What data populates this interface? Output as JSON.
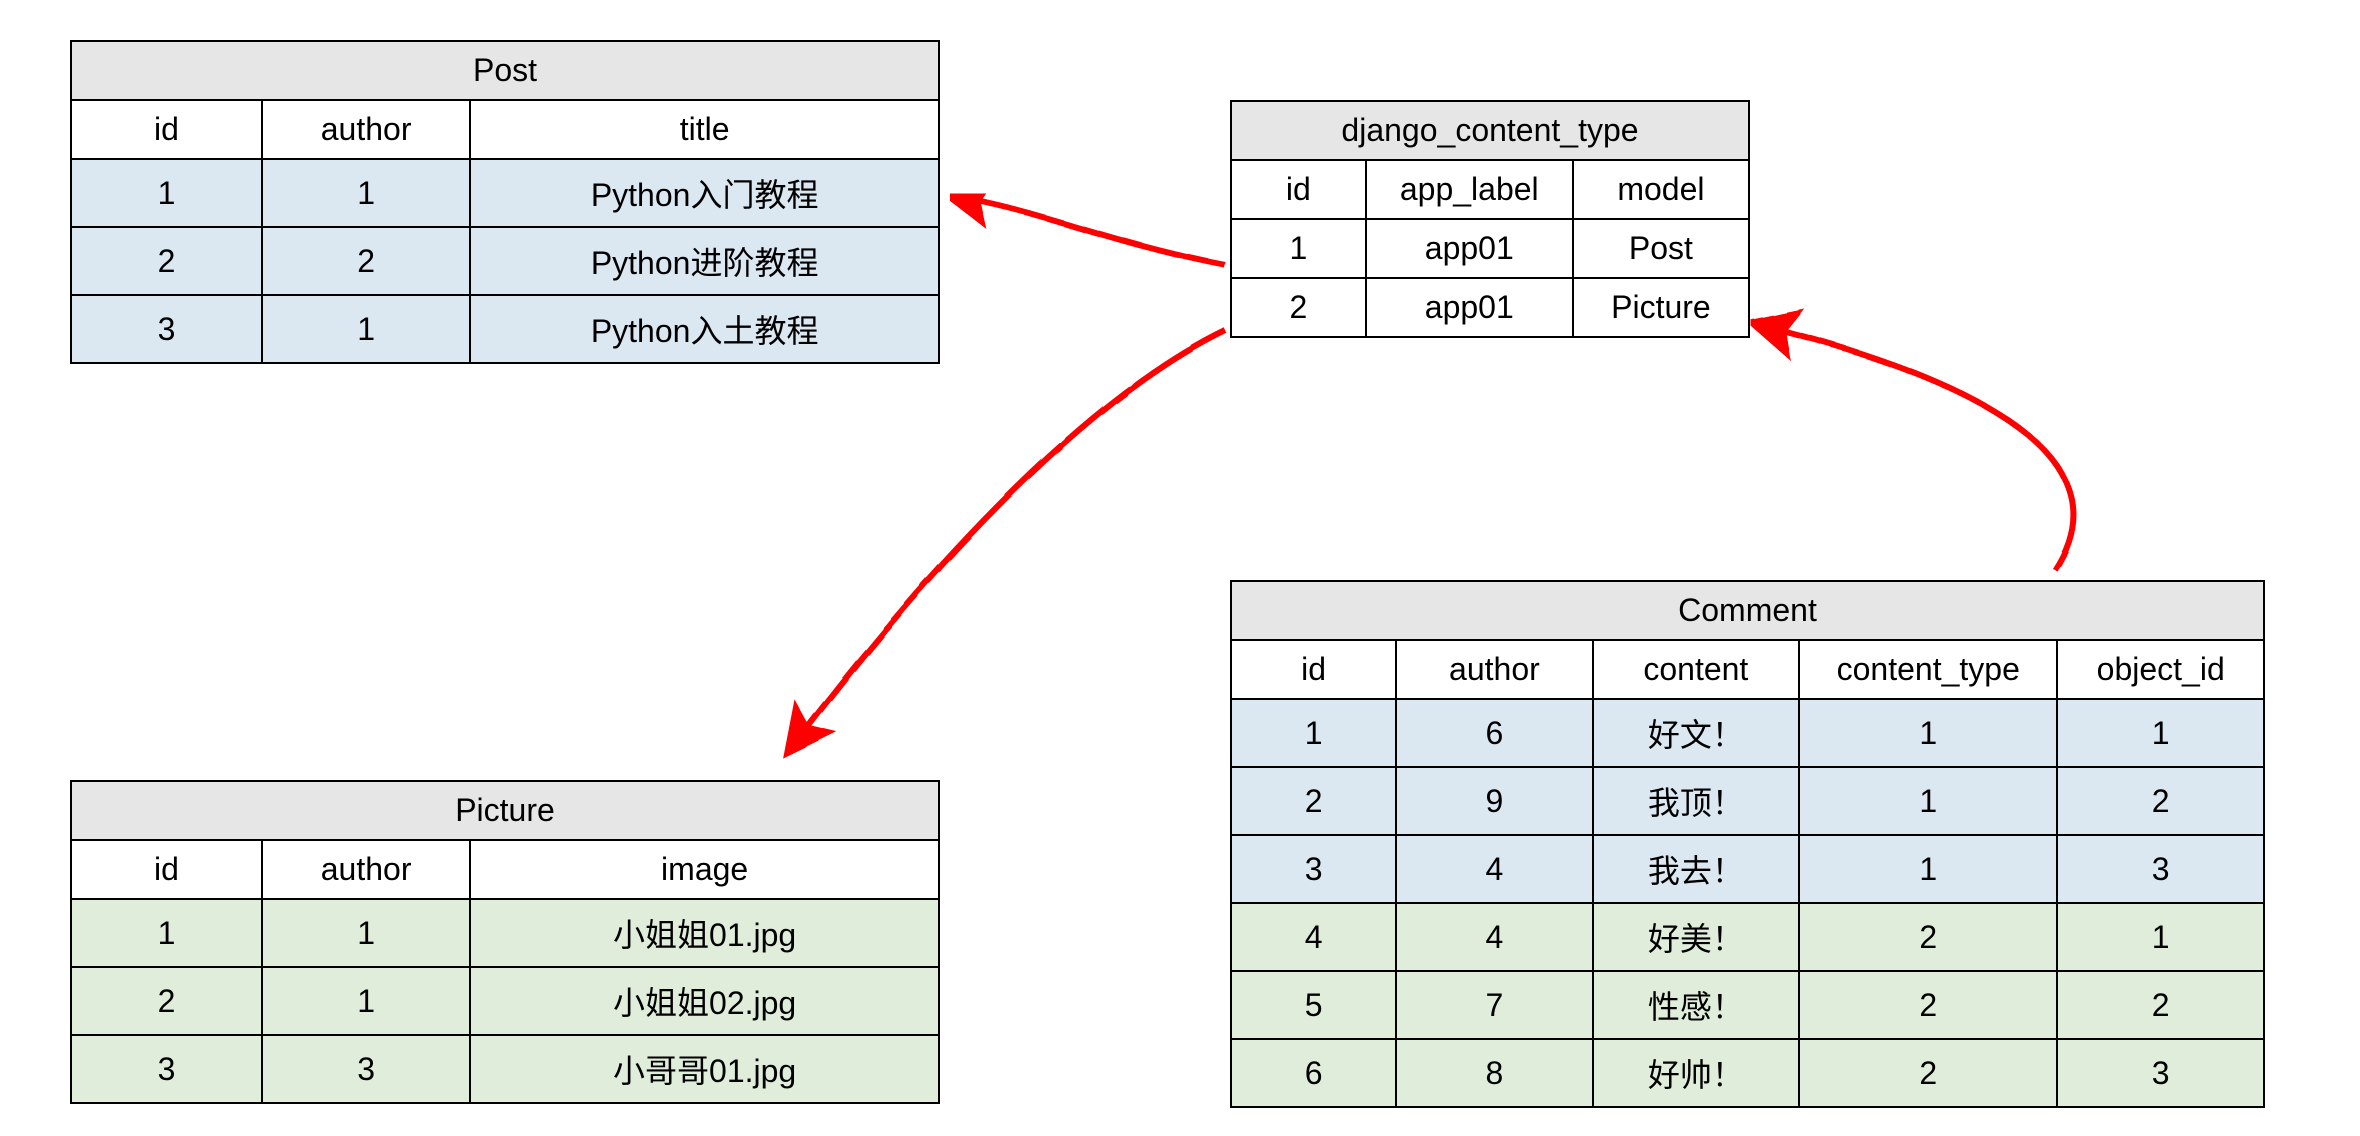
{
  "tables": {
    "post": {
      "title": "Post",
      "columns": [
        "id",
        "author",
        "title"
      ],
      "rows": [
        {
          "cells": [
            "1",
            "1",
            "Python入门教程"
          ],
          "color": "blue"
        },
        {
          "cells": [
            "2",
            "2",
            "Python进阶教程"
          ],
          "color": "blue"
        },
        {
          "cells": [
            "3",
            "1",
            "Python入土教程"
          ],
          "color": "blue"
        }
      ]
    },
    "content_type": {
      "title": "django_content_type",
      "columns": [
        "id",
        "app_label",
        "model"
      ],
      "rows": [
        {
          "cells": [
            "1",
            "app01",
            "Post"
          ],
          "color": "white"
        },
        {
          "cells": [
            "2",
            "app01",
            "Picture"
          ],
          "color": "white"
        }
      ]
    },
    "picture": {
      "title": "Picture",
      "columns": [
        "id",
        "author",
        "image"
      ],
      "rows": [
        {
          "cells": [
            "1",
            "1",
            "小姐姐01.jpg"
          ],
          "color": "green"
        },
        {
          "cells": [
            "2",
            "1",
            "小姐姐02.jpg"
          ],
          "color": "green"
        },
        {
          "cells": [
            "3",
            "3",
            "小哥哥01.jpg"
          ],
          "color": "green"
        }
      ]
    },
    "comment": {
      "title": "Comment",
      "columns": [
        "id",
        "author",
        "content",
        "content_type",
        "object_id"
      ],
      "rows": [
        {
          "cells": [
            "1",
            "6",
            "好文！",
            "1",
            "1"
          ],
          "color": "blue"
        },
        {
          "cells": [
            "2",
            "9",
            "我顶！",
            "1",
            "2"
          ],
          "color": "blue"
        },
        {
          "cells": [
            "3",
            "4",
            "我去！",
            "1",
            "3"
          ],
          "color": "blue"
        },
        {
          "cells": [
            "4",
            "4",
            "好美！",
            "2",
            "1"
          ],
          "color": "green"
        },
        {
          "cells": [
            "5",
            "7",
            "性感！",
            "2",
            "2"
          ],
          "color": "green"
        },
        {
          "cells": [
            "6",
            "8",
            "好帅！",
            "2",
            "3"
          ],
          "color": "green"
        }
      ]
    }
  },
  "arrows": [
    {
      "from": "content_type_row1",
      "to": "post",
      "desc": "content_type 1 -> Post"
    },
    {
      "from": "content_type_row2",
      "to": "picture",
      "desc": "content_type 2 -> Picture"
    },
    {
      "from": "comment_content_type",
      "to": "content_type",
      "desc": "Comment.content_type -> django_content_type"
    }
  ],
  "colors": {
    "arrow": "#ff0000",
    "header_bg": "#e6e6e6",
    "blue_row": "#dbe8f2",
    "green_row": "#e0edda"
  }
}
